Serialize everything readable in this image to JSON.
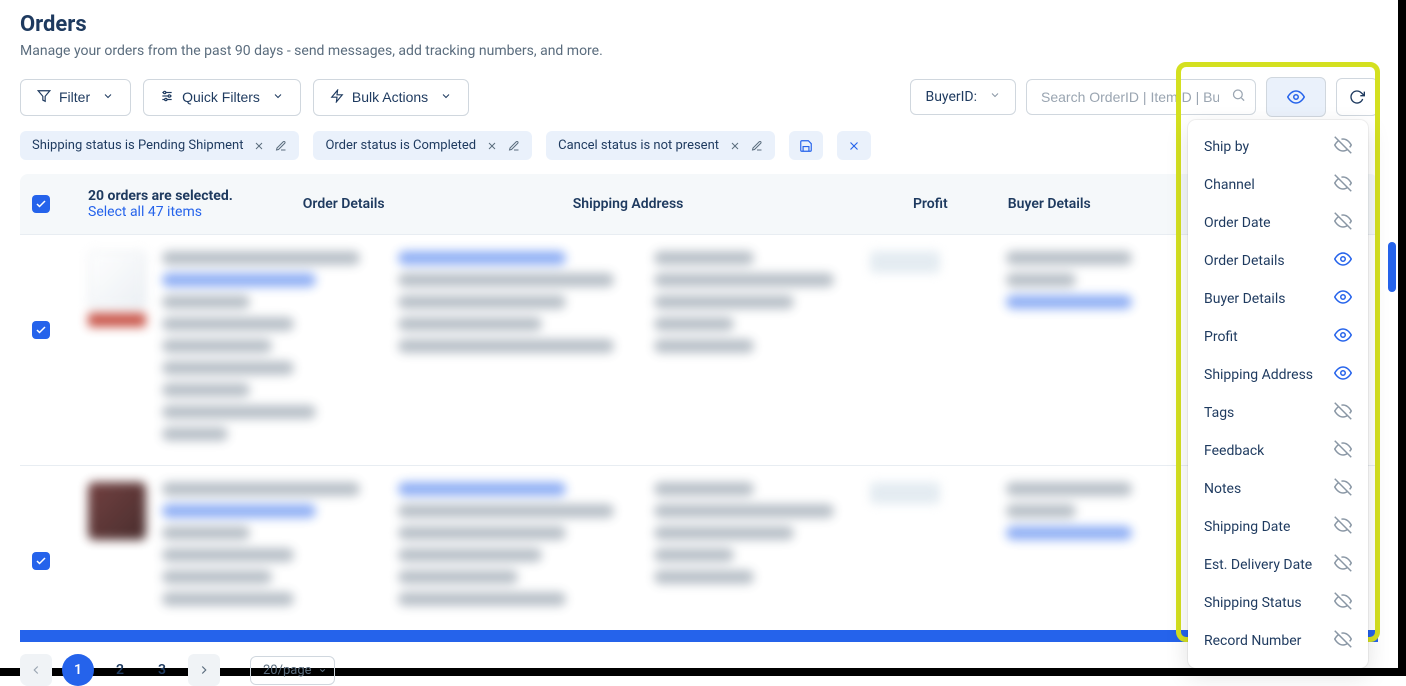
{
  "header": {
    "title": "Orders",
    "subtitle": "Manage your orders from the past 90 days - send messages, add tracking numbers, and more."
  },
  "toolbar": {
    "filter": "Filter",
    "quick_filters": "Quick Filters",
    "bulk_actions": "Bulk Actions",
    "buyer_select": "BuyerID:",
    "search_placeholder": "Search OrderID | ItemID | BuyerID"
  },
  "chips": {
    "c1": "Shipping status is Pending Shipment",
    "c2": "Order status is Completed",
    "c3": "Cancel status is not present"
  },
  "table": {
    "selected_text": "20 orders are selected.",
    "select_all_text": "Select all 47 items",
    "columns": {
      "order_details": "Order Details",
      "shipping_address": "Shipping Address",
      "profit": "Profit",
      "buyer_details": "Buyer Details"
    }
  },
  "pagination": {
    "p1": "1",
    "p2": "2",
    "p3": "3",
    "page_size": "20/page"
  },
  "columns_dropdown": [
    {
      "label": "Ship by",
      "visible": false
    },
    {
      "label": "Channel",
      "visible": false
    },
    {
      "label": "Order Date",
      "visible": false
    },
    {
      "label": "Order Details",
      "visible": true
    },
    {
      "label": "Buyer Details",
      "visible": true
    },
    {
      "label": "Profit",
      "visible": true
    },
    {
      "label": "Shipping Address",
      "visible": true
    },
    {
      "label": "Tags",
      "visible": false
    },
    {
      "label": "Feedback",
      "visible": false
    },
    {
      "label": "Notes",
      "visible": false
    },
    {
      "label": "Shipping Date",
      "visible": false
    },
    {
      "label": "Est. Delivery Date",
      "visible": false
    },
    {
      "label": "Shipping Status",
      "visible": false
    },
    {
      "label": "Record Number",
      "visible": false
    }
  ]
}
